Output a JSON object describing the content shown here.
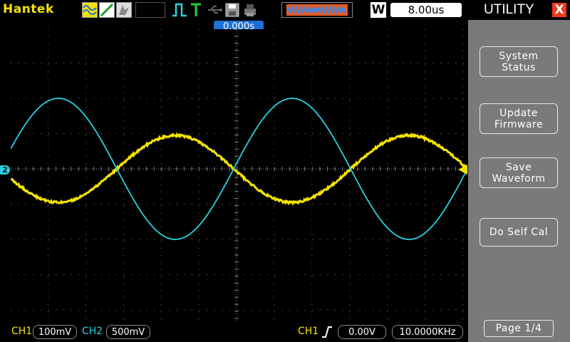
{
  "brand": "Hantek",
  "topbar": {
    "icons": [
      "waveform-icon",
      "edge-icon",
      "cursor-icon",
      "run-icon",
      "trigger-icon",
      "usb-icon",
      "save-icon",
      "print-icon",
      "memory-icon"
    ],
    "wbox_label": "W",
    "timebase": "8.00us"
  },
  "trigger_position": "0.000s",
  "channel_marker": "2",
  "bottombar": {
    "ch1_label": "CH1",
    "ch1_scale": "100mV",
    "ch2_label": "CH2",
    "ch2_scale": "500mV",
    "trig_ch": "CH1",
    "trig_level": "0.00V",
    "frequency": "10.0000KHz"
  },
  "menu": {
    "title": "UTILITY",
    "close": "X",
    "buttons": [
      {
        "line1": "System",
        "line2": "Status"
      },
      {
        "line1": "Update",
        "line2": "Firmware"
      },
      {
        "line1": "Save",
        "line2": "Waveform"
      },
      {
        "line1": "Do Self Cal",
        "line2": ""
      }
    ],
    "page": "Page 1/4"
  },
  "colors": {
    "ch1": "#f5e400",
    "ch2": "#27d3e0",
    "grid": "#7a7a7a",
    "accent": "#2070d8"
  },
  "chart_data": {
    "type": "line",
    "series": [
      {
        "name": "CH1",
        "color": "#f5e400",
        "shape": "sine",
        "amplitude_div": 0.95,
        "phase": "inverted",
        "period_div": 6.2,
        "cross_div": 6.3
      },
      {
        "name": "CH2",
        "color": "#27d3e0",
        "shape": "sine",
        "amplitude_div": 2.0,
        "phase": "inverted",
        "period_div": 6.2,
        "cross_div": 6.3
      }
    ],
    "grid": true,
    "divisions": {
      "x": 12,
      "y": 8
    }
  }
}
